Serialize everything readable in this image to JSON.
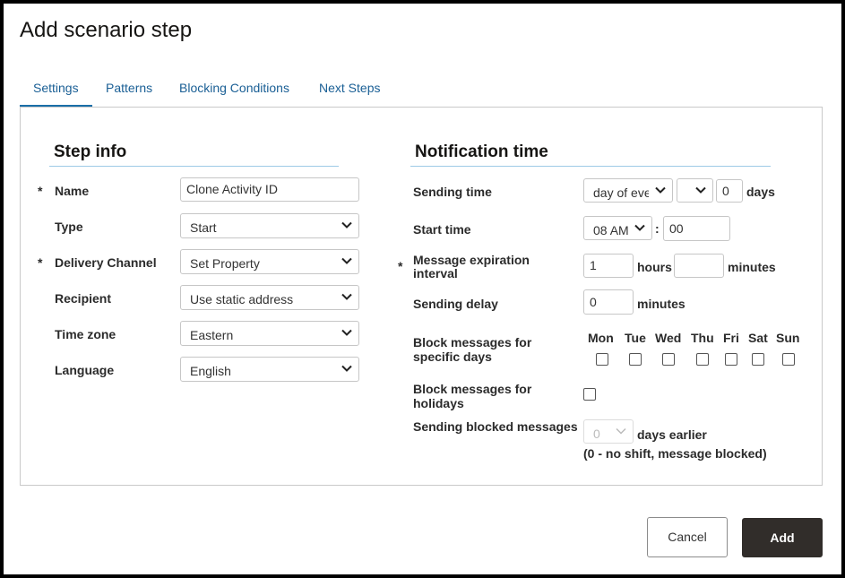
{
  "dialog": {
    "title": "Add scenario step"
  },
  "tabs": [
    {
      "label": "Settings"
    },
    {
      "label": "Patterns"
    },
    {
      "label": "Blocking Conditions"
    },
    {
      "label": "Next Steps"
    }
  ],
  "step_info": {
    "title": "Step info",
    "required_mark": "*",
    "name": {
      "label": "Name",
      "value": "Clone Activity ID"
    },
    "type": {
      "label": "Type",
      "value": "Start"
    },
    "delivery_channel": {
      "label": "Delivery Channel",
      "value": "Set Property"
    },
    "recipient": {
      "label": "Recipient",
      "value": "Use static address"
    },
    "time_zone": {
      "label": "Time zone",
      "value": "Eastern"
    },
    "language": {
      "label": "Language",
      "value": "English"
    }
  },
  "notification": {
    "title": "Notification time",
    "required_mark": "*",
    "sending_time": {
      "label": "Sending time",
      "select1": "day of eve",
      "select2": "",
      "days_value": "0",
      "days_unit": "days"
    },
    "start_time": {
      "label": "Start time",
      "hour": "08 AM",
      "separator": ":",
      "minutes": "00"
    },
    "expiration": {
      "label_line1": "Message expiration",
      "label_line2": "interval",
      "hours_value": "1",
      "hours_unit": "hours",
      "minutes_value": "",
      "minutes_unit": "minutes"
    },
    "sending_delay": {
      "label": "Sending delay",
      "value": "0",
      "unit": "minutes"
    },
    "block_days": {
      "label_line1": "Block messages for",
      "label_line2": "specific days",
      "days": [
        "Mon",
        "Tue",
        "Wed",
        "Thu",
        "Fri",
        "Sat",
        "Sun"
      ]
    },
    "block_holidays": {
      "label_line1": "Block messages for",
      "label_line2": "holidays"
    },
    "blocked_messages": {
      "label": "Sending blocked messages",
      "value": "0",
      "unit": "days earlier",
      "note": "(0 - no shift, message blocked)"
    }
  },
  "footer": {
    "cancel_label": "Cancel",
    "add_label": "Add"
  }
}
